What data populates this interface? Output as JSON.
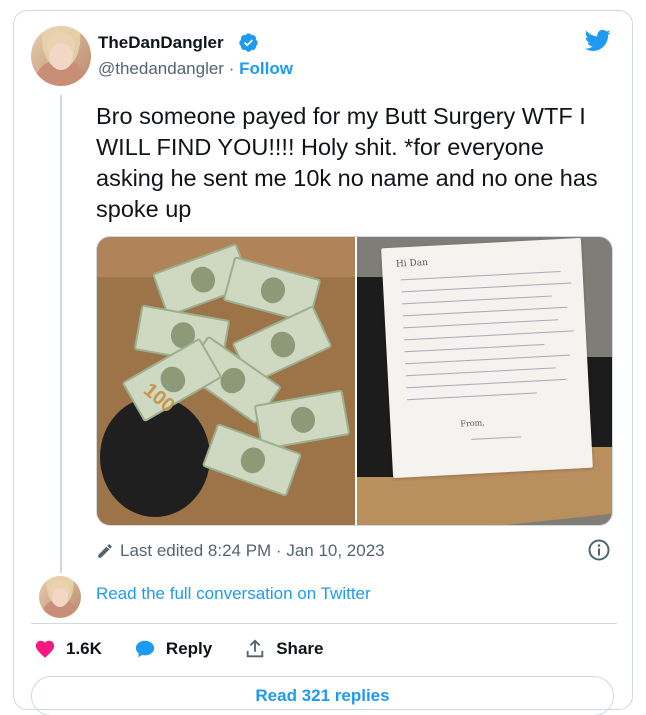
{
  "user": {
    "display_name": "TheDanDangler",
    "handle": "@thedandangler",
    "separator": "·",
    "follow_label": "Follow"
  },
  "tweet": {
    "text": "Bro someone payed for my Butt Surgery WTF I WILL FIND YOU!!!! Holy shit. *for everyone asking he sent me 10k no name and no one has spoke up",
    "edited_label": "Last edited 8:24 PM · Jan 10, 2023"
  },
  "media": {
    "left_caption": "100",
    "note_greeting": "Hi Dan",
    "note_signoff": "From,"
  },
  "conversation": {
    "link_label": "Read the full conversation on Twitter"
  },
  "actions": {
    "like_count": "1.6K",
    "reply_label": "Reply",
    "share_label": "Share"
  },
  "footer": {
    "read_replies_label": "Read 321 replies"
  },
  "colors": {
    "accent": "#1d9bf0",
    "like": "#f91880",
    "text": "#0f1419",
    "muted": "#536471",
    "border": "#cfd9de"
  },
  "icons": {
    "verified": "verified-badge-icon",
    "brand": "twitter-bird-icon",
    "edit": "pencil-icon",
    "info": "info-icon",
    "like": "heart-icon",
    "reply": "speech-bubble-icon",
    "share": "share-upload-icon"
  }
}
